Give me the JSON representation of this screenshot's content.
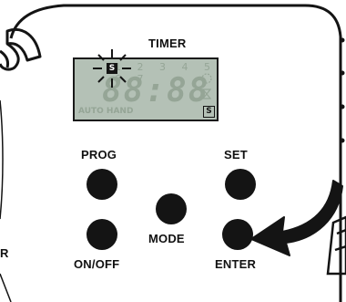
{
  "device": {
    "title": "TIMER",
    "lcd": {
      "days": "1 2 3 4 5 6 7",
      "digits": "88:88",
      "mode_indicators": "AUTO HAND",
      "s_indicator": "S"
    },
    "buttons": {
      "prog": "PROG",
      "set": "SET",
      "mode": "MODE",
      "onoff": "ON/OFF",
      "enter": "ENTER"
    },
    "edge_letter": "R"
  }
}
